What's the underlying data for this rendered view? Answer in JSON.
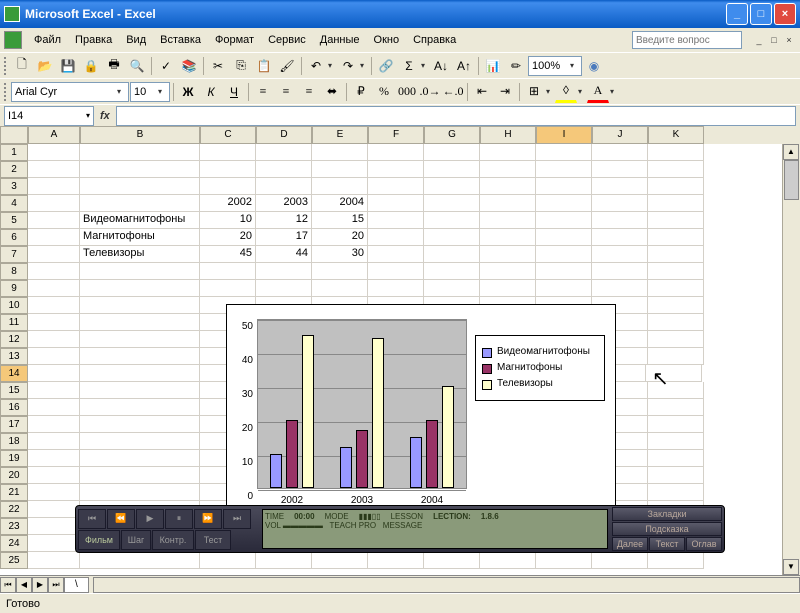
{
  "window": {
    "title": "Microsoft Excel - Excel"
  },
  "menu": [
    "Файл",
    "Правка",
    "Вид",
    "Вставка",
    "Формат",
    "Сервис",
    "Данные",
    "Окно",
    "Справка"
  ],
  "question_placeholder": "Введите вопрос",
  "font": {
    "name": "Arial Cyr",
    "size": "10"
  },
  "zoom": "100%",
  "name_box": "I14",
  "status": "Готово",
  "cols": [
    "A",
    "B",
    "C",
    "D",
    "E",
    "F",
    "G",
    "H",
    "I",
    "J",
    "K"
  ],
  "active_col": "I",
  "active_row": 14,
  "table": {
    "header_row": 4,
    "headers": {
      "C": "2002",
      "D": "2003",
      "E": "2004"
    },
    "rows": [
      {
        "r": 5,
        "B": "Видеомагнитофоны",
        "C": "10",
        "D": "12",
        "E": "15"
      },
      {
        "r": 6,
        "B": "Магнитофоны",
        "C": "20",
        "D": "17",
        "E": "20"
      },
      {
        "r": 7,
        "B": "Телевизоры",
        "C": "45",
        "D": "44",
        "E": "30"
      }
    ]
  },
  "chart_data": {
    "type": "bar",
    "categories": [
      "2002",
      "2003",
      "2004"
    ],
    "series": [
      {
        "name": "Видеомагнитофоны",
        "values": [
          10,
          12,
          15
        ],
        "color": "#9999ff"
      },
      {
        "name": "Магнитофоны",
        "values": [
          20,
          17,
          20
        ],
        "color": "#993366"
      },
      {
        "name": "Телевизоры",
        "values": [
          45,
          44,
          30
        ],
        "color": "#ffffcc"
      }
    ],
    "ylim": [
      0,
      50
    ],
    "yticks": [
      0,
      10,
      20,
      30,
      40,
      50
    ]
  },
  "player": {
    "tabs": [
      "Фильм",
      "Шаг",
      "Контр.",
      "Тест"
    ],
    "time_label": "TIME",
    "time": "00:00",
    "mode": "MODE",
    "lesson": "LESSON",
    "lection": "LECTION:",
    "lection_val": "1.8.6",
    "right": [
      "Закладки",
      "Подсказка"
    ],
    "bottom": [
      "Далее",
      "Текст",
      "Оглав"
    ]
  }
}
